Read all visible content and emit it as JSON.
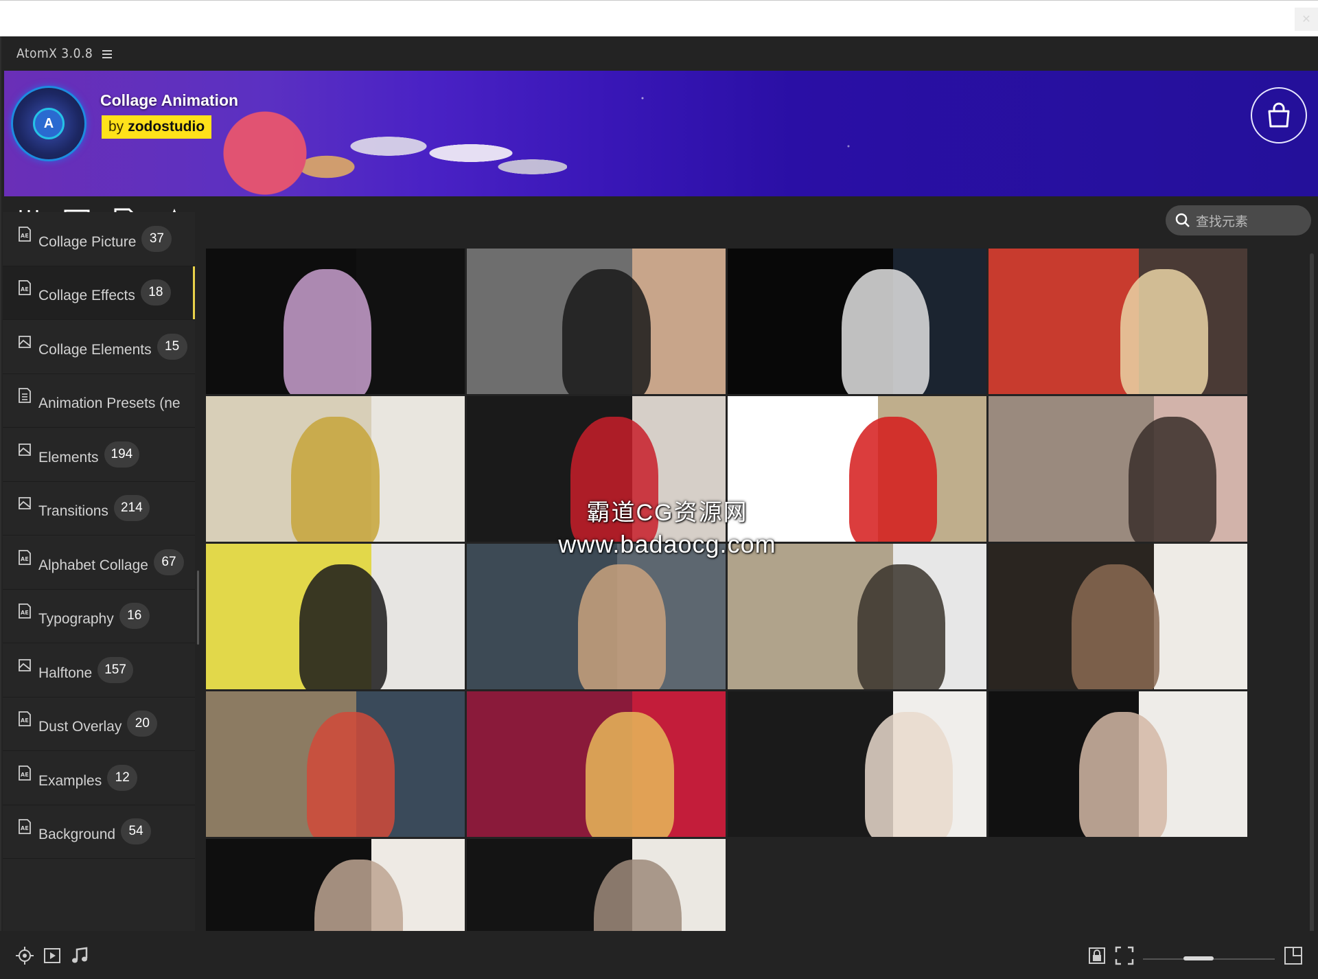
{
  "app": {
    "title": "AtomX 3.0.8"
  },
  "banner": {
    "title": "Collage Animation",
    "by_prefix": "by",
    "author": "zodostudio",
    "logo_letter": "A"
  },
  "toolbar": {
    "icons": [
      "sliders-icon",
      "list-icon",
      "media-file-icon",
      "star-icon"
    ],
    "search_placeholder": "查找元素"
  },
  "sidebar": {
    "items": [
      {
        "label": "Collage Picture",
        "count": "37",
        "icon": "ae-file-icon",
        "active": false
      },
      {
        "label": "Collage Effects",
        "count": "18",
        "icon": "ae-file-icon",
        "active": true
      },
      {
        "label": "Collage Elements",
        "count": "15",
        "icon": "media-icon",
        "active": false
      },
      {
        "label": "Animation Presets (ne",
        "count": "",
        "icon": "preset-doc-icon",
        "active": false
      },
      {
        "label": "Elements",
        "count": "194",
        "icon": "media-icon",
        "active": false
      },
      {
        "label": "Transitions",
        "count": "214",
        "icon": "media-icon",
        "active": false
      },
      {
        "label": "Alphabet Collage",
        "count": "67",
        "icon": "ae-file-icon",
        "active": false
      },
      {
        "label": "Typography",
        "count": "16",
        "icon": "ae-file-icon",
        "active": false
      },
      {
        "label": "Halftone",
        "count": "157",
        "icon": "media-icon",
        "active": false
      },
      {
        "label": "Dust Overlay",
        "count": "20",
        "icon": "ae-file-icon",
        "active": false
      },
      {
        "label": "Examples",
        "count": "12",
        "icon": "ae-file-icon",
        "active": false
      },
      {
        "label": "Background",
        "count": "54",
        "icon": "ae-file-icon",
        "active": false
      }
    ]
  },
  "watermark": {
    "line1": "霸道CG资源网",
    "line2": "www.badaocg.com"
  },
  "thumbnails": [
    {
      "name": "thumb-1",
      "bg": "#0d0d0d",
      "accent": "#c9a0cf",
      "right": "#111111"
    },
    {
      "name": "thumb-2",
      "bg": "#6e6e6e",
      "accent": "#1a1a1a",
      "right": "#c8a58a"
    },
    {
      "name": "thumb-3",
      "bg": "#080808",
      "accent": "#e0e0e0",
      "right": "#1b2430"
    },
    {
      "name": "thumb-4",
      "bg": "#c83b2e",
      "accent": "#e9d3a4",
      "right": "#4a3a35"
    },
    {
      "name": "thumb-5",
      "bg": "#d8cfb8",
      "accent": "#c7a43a",
      "right": "#e9e6df"
    },
    {
      "name": "thumb-6",
      "bg": "#1a1a1a",
      "accent": "#c81f2a",
      "right": "#d6cfc8"
    },
    {
      "name": "thumb-7",
      "bg": "#ffffff",
      "accent": "#d51b1b",
      "right": "#bfae8c"
    },
    {
      "name": "thumb-8",
      "bg": "#9a8a7e",
      "accent": "#3a2e2a",
      "right": "#d2b3aa"
    },
    {
      "name": "thumb-9",
      "bg": "#e2d84a",
      "accent": "#1b1b1b",
      "right": "#e7e5e2"
    },
    {
      "name": "thumb-10",
      "bg": "#3d4a55",
      "accent": "#c9a27e",
      "right": "#5d6770"
    },
    {
      "name": "thumb-11",
      "bg": "#b0a38b",
      "accent": "#3a342c",
      "right": "#e7e7e7"
    },
    {
      "name": "thumb-12",
      "bg": "#2a2520",
      "accent": "#8a6a52",
      "right": "#eeebe6"
    },
    {
      "name": "thumb-13",
      "bg": "#8c7b62",
      "accent": "#d14a3a",
      "right": "#3a4a5a"
    },
    {
      "name": "thumb-14",
      "bg": "#8a1a3a",
      "accent": "#e6b85a",
      "right": "#c31d3a"
    },
    {
      "name": "thumb-15",
      "bg": "#1a1a1a",
      "accent": "#e9d9cc",
      "right": "#f0eeeb"
    },
    {
      "name": "thumb-16",
      "bg": "#111111",
      "accent": "#d4b9a6",
      "right": "#eeece8"
    },
    {
      "name": "thumb-17",
      "bg": "#0f0f0f",
      "accent": "#bda592",
      "right": "#eeeae4"
    },
    {
      "name": "thumb-18",
      "bg": "#141414",
      "accent": "#9d8a7a",
      "right": "#ebe8e2"
    }
  ],
  "bottom": {
    "icons": [
      "target-settings-icon",
      "video-preview-icon",
      "music-note-icon",
      "lock-icon",
      "fit-screen-icon",
      "expand-icon"
    ],
    "zoom_level": 0.5
  }
}
